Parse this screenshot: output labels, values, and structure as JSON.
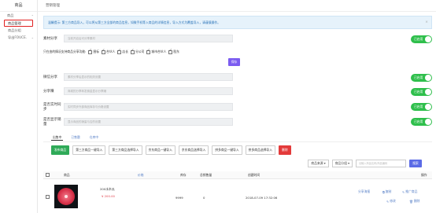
{
  "sidebar": {
    "title": "商品",
    "group": "商品",
    "items": [
      "商品管理",
      "商品分组",
      "导出FOUCE."
    ]
  },
  "topbar": {
    "title": "营销管理"
  },
  "alert": {
    "text": "温馨提示: 第三方商品导入，可以将从第三方全部的商品信息，如微手机等入商品的详情信息，导入方式为覆盖导入，请谨慎操作。"
  },
  "material": {
    "label": "素材分享",
    "placeholder": "当前开启后可分享素材",
    "toggle": "已启用",
    "checks_label": "只在由的情况支持商品分享功能:",
    "checks": [
      {
        "label": "图标",
        "checked": true
      },
      {
        "label": "合伙人",
        "checked": true
      },
      {
        "label": "店长",
        "checked": true
      },
      {
        "label": "分公司",
        "checked": true
      },
      {
        "label": "城市合伙人",
        "checked": true
      },
      {
        "label": "股东",
        "checked": true
      }
    ],
    "save": "保存"
  },
  "settings": [
    {
      "label": "微信分享",
      "placeholder": "素材分享后显示的相关设置",
      "toggle": "已启用"
    },
    {
      "label": "分享赚",
      "placeholder": "商城的分享转发佣金显示分享赚",
      "toggle": "已启用"
    },
    {
      "label": "是否实时同步",
      "placeholder": "实时同步外部商品库存与价格设置",
      "toggle": "已启用"
    },
    {
      "label": "是否显示销量",
      "placeholder": "显示商品的销量与否的设置",
      "toggle": "已启用"
    }
  ],
  "tabs": [
    "出售中",
    "已售罄",
    "仓库中"
  ],
  "actions": {
    "publish": "发布商品",
    "import_buttons": [
      "第三方商品一键导入",
      "第三方商品选择导入",
      "京东商品一键导入",
      "京东商品选择导入",
      "拼多商品一键导入",
      "拼多商品选择导入"
    ],
    "delete": "删除"
  },
  "filters": {
    "source": "商品来源 ▾",
    "group": "商品分组 ▾",
    "search_placeholder": "请输入商品名称/商品编码",
    "search_btn": "搜索"
  },
  "table": {
    "headers": {
      "product": "商品",
      "price": "价格",
      "stock": "库存",
      "sales": "总销售量",
      "created": "创建时间",
      "ops": "操作"
    },
    "rows": [
      {
        "name": "200水木瓜",
        "price": "¥ 200.00",
        "stock": "9999",
        "sales": "0",
        "created": "2018-07-09 17:32:06",
        "ops": [
          "分享海报",
          "复制",
          "推广商品",
          "修改",
          "删除"
        ]
      }
    ]
  },
  "colors": {
    "accent": "#7b5cf0",
    "toggle": "#2fbf4c",
    "publish": "#2faa58",
    "delete": "#e33a3a",
    "search": "#5b6be6",
    "price": "#e0434d"
  }
}
